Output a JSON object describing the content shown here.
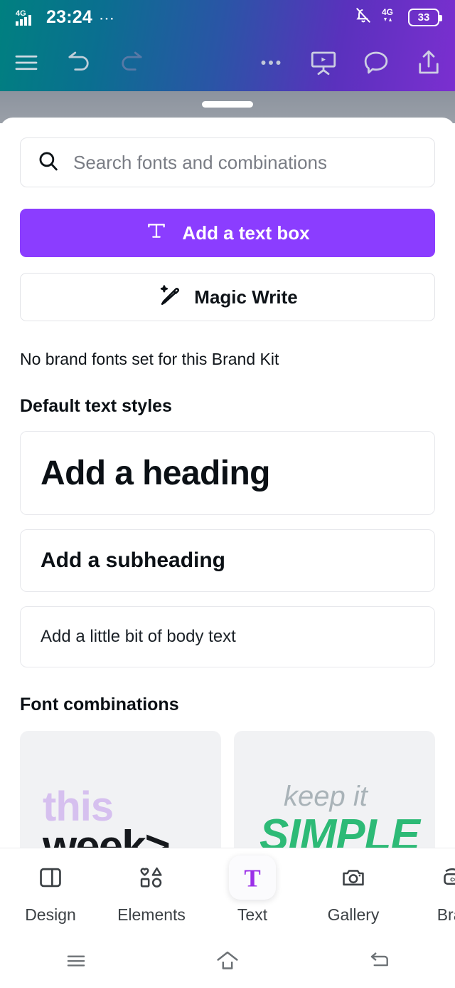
{
  "status_bar": {
    "network_label": "4G",
    "time": "23:24",
    "overflow_dots": "⋯",
    "notifications_muted_icon": "bell-off-icon",
    "data_network_label": "4G",
    "battery_percent": "33"
  },
  "toolbar": {
    "menu_label": "menu-icon",
    "undo_label": "undo-icon",
    "redo_label": "redo-icon",
    "more_label": "more-options-icon",
    "present_label": "present-icon",
    "comment_label": "comment-icon",
    "share_label": "share-icon"
  },
  "panel": {
    "drag_handle": "drag-handle",
    "search": {
      "placeholder": "Search fonts and combinations",
      "value": "",
      "icon": "search-icon"
    },
    "add_text_box": {
      "label": "Add a text box",
      "icon": "text-tool-icon",
      "color": "#8b3dff"
    },
    "magic_write": {
      "label": "Magic Write",
      "icon": "magic-pencil-icon"
    },
    "brand_kit_note": "No brand fonts set for this Brand Kit",
    "default_styles": {
      "title": "Default text styles",
      "items": [
        {
          "label": "Add a heading"
        },
        {
          "label": "Add a subheading"
        },
        {
          "label": "Add a little bit of body text"
        }
      ]
    },
    "font_combinations": {
      "title": "Font combinations",
      "cards": [
        {
          "line1": "this",
          "line2": "week>",
          "line1_color": "#d6c0ef",
          "line2_color": "#15181c"
        },
        {
          "line1": "keep it",
          "line2": "SIMPLE",
          "line1_color": "#a9b3b8",
          "line2_color": "#2dba76"
        }
      ]
    }
  },
  "tabs": [
    {
      "label": "Design",
      "icon": "design-layout-icon",
      "active": false
    },
    {
      "label": "Elements",
      "icon": "shapes-icon",
      "active": false
    },
    {
      "label": "Text",
      "icon": "text-icon",
      "active": true
    },
    {
      "label": "Gallery",
      "icon": "camera-icon",
      "active": false
    },
    {
      "label": "Bran",
      "icon": "brand-kit-icon",
      "active": false
    }
  ],
  "system_nav": {
    "recents": "recents-icon",
    "home": "home-icon",
    "back": "back-icon"
  }
}
